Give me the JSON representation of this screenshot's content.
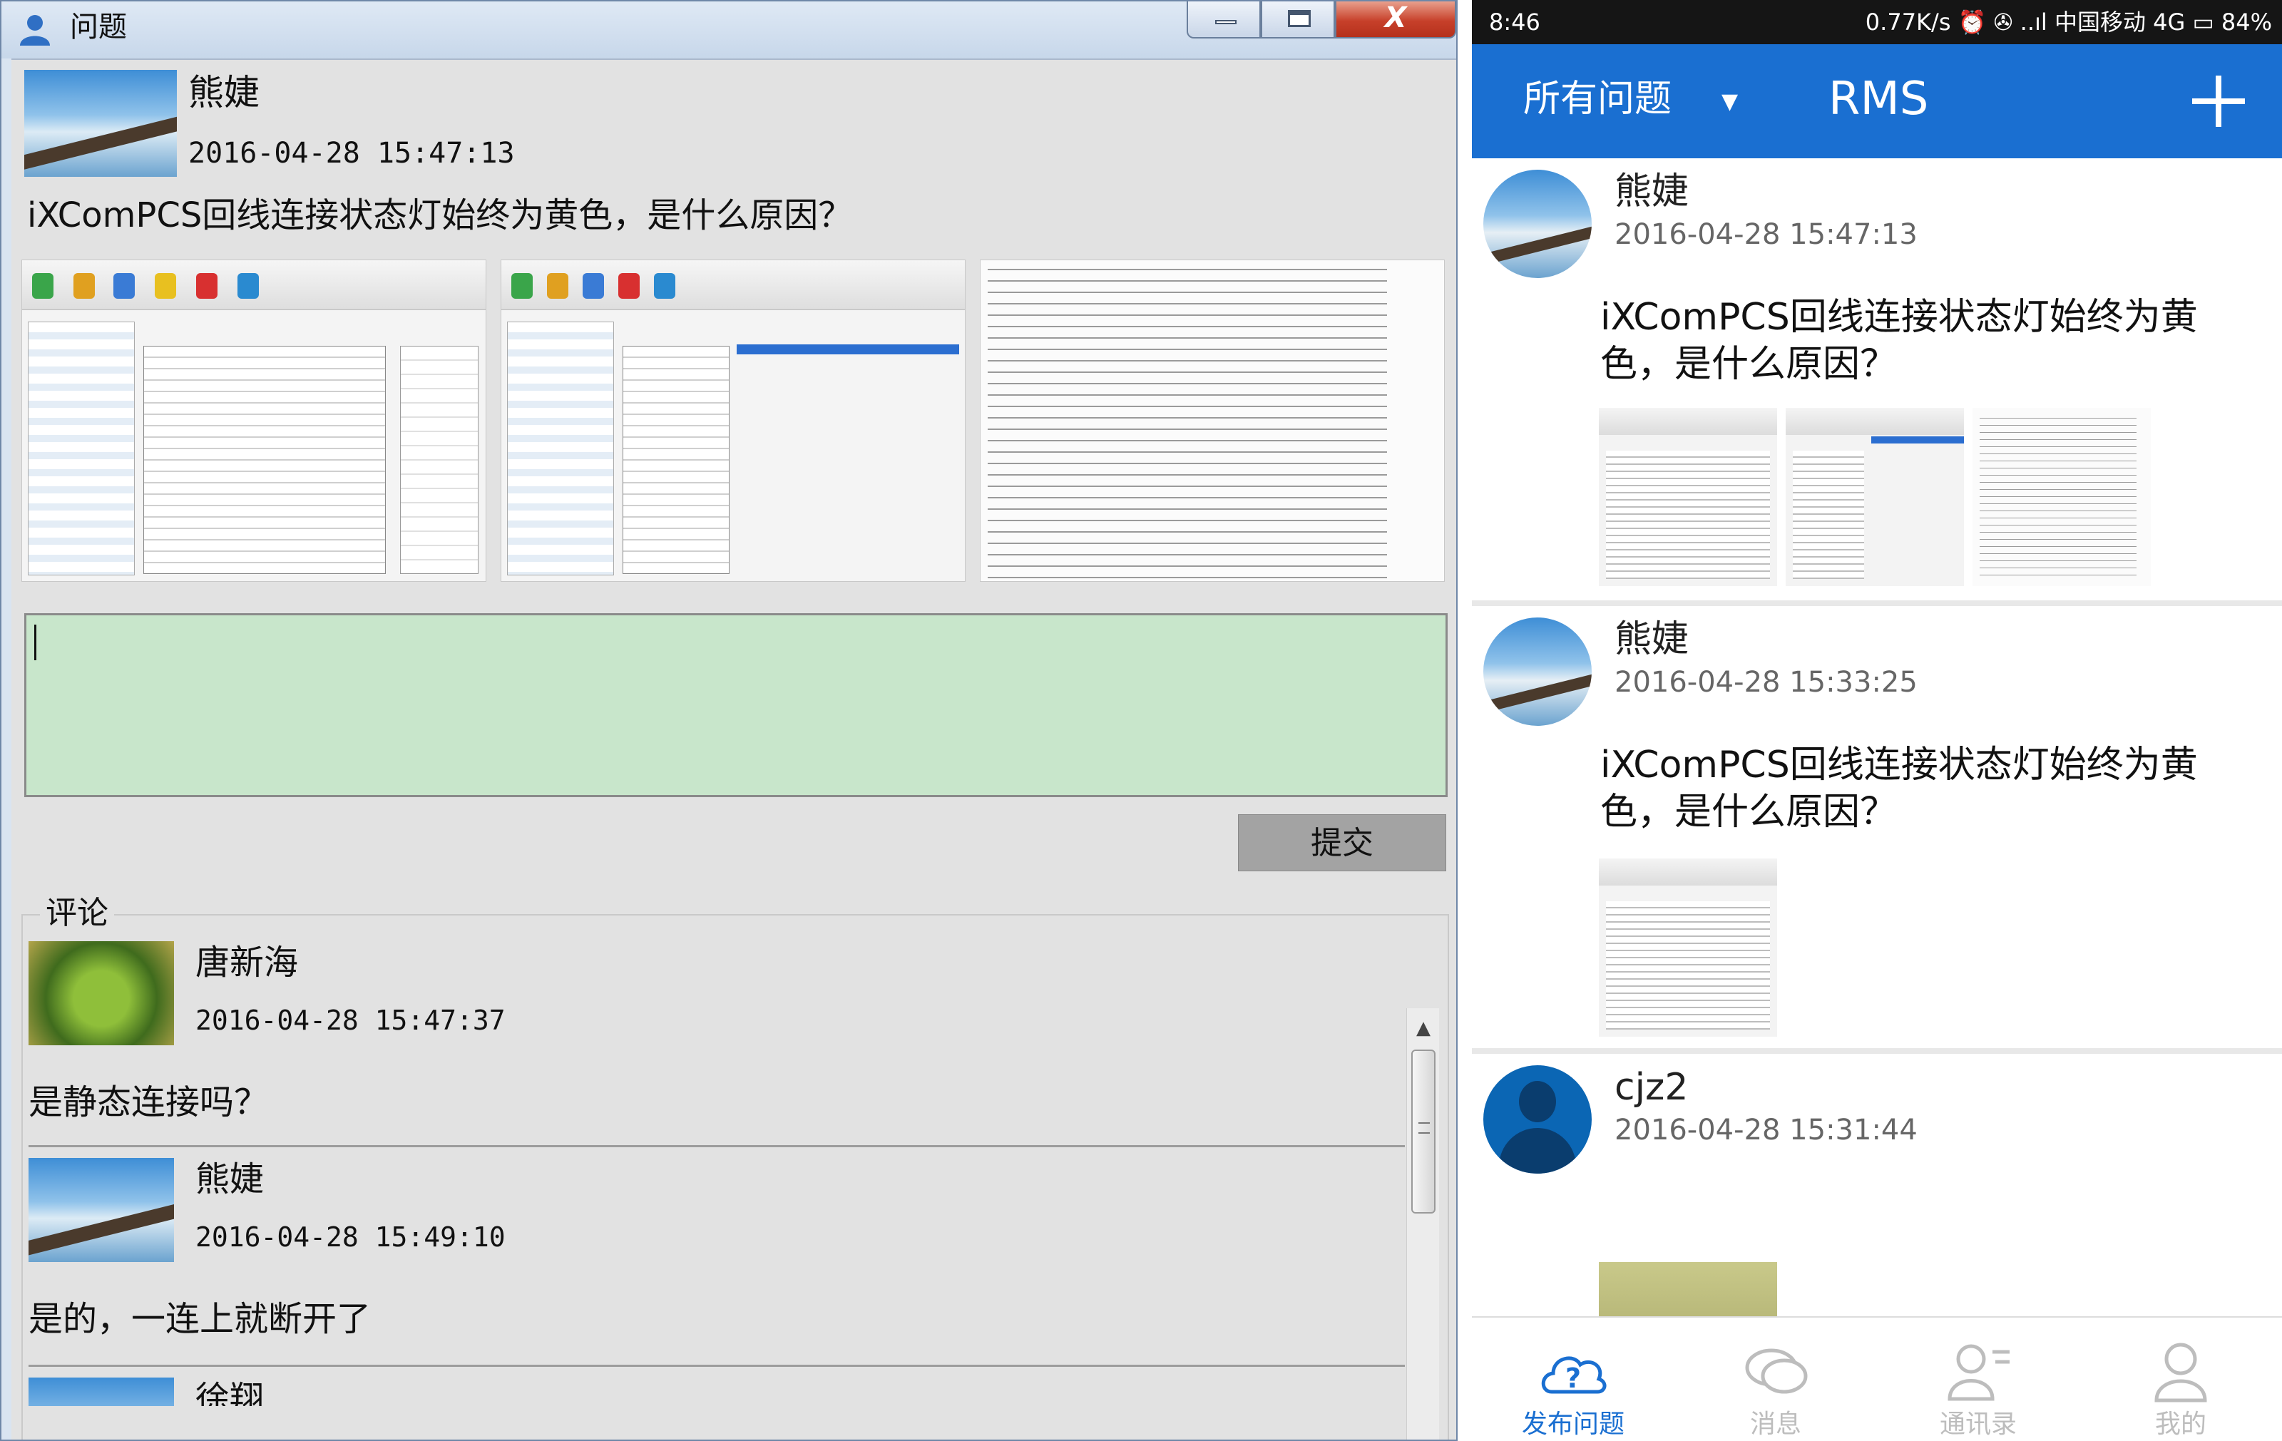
{
  "desktop": {
    "window_title": "问题",
    "close_glyph": "X",
    "question": {
      "author": "熊婕",
      "time": "2016-04-28 15:47:13",
      "text": "iXComPCS回线连接状态灯始终为黄色，是什么原因？",
      "image_count": 3
    },
    "reply": {
      "value": ""
    },
    "submit_label": "提交",
    "comments_label": "评论",
    "comments": [
      {
        "author": "唐新海",
        "time": "2016-04-28 15:47:37",
        "text": "是静态连接吗？"
      },
      {
        "author": "熊婕",
        "time": "2016-04-28 15:49:10",
        "text": "是的，一连上就断开了"
      },
      {
        "author": "徐翔",
        "time": "",
        "text": ""
      }
    ],
    "scroll_up_glyph": "▲",
    "scroll_down_glyph": "▼"
  },
  "mobile": {
    "status": {
      "time": "8:46",
      "info": "0.77K/s ⏰ ✇ ..ıl 中国移动 4G ▭ 84%"
    },
    "filter": {
      "label": "所有问题",
      "arrow": "▼"
    },
    "app_title": "RMS",
    "questions": [
      {
        "author": "熊婕",
        "time": "2016-04-28 15:47:13",
        "text": "iXComPCS回线连接状态灯始终为黄色，是什么原因？",
        "avatar": "landscape-photo"
      },
      {
        "author": "熊婕",
        "time": "2016-04-28 15:33:25",
        "text": "iXComPCS回线连接状态灯始终为黄色，是什么原因？",
        "avatar": "landscape-photo"
      },
      {
        "author": "cjz2",
        "time": "2016-04-28 15:31:44",
        "text": "",
        "avatar": "person-icon"
      }
    ],
    "nav": [
      {
        "label": "发布问题",
        "icon": "cloud-question-icon",
        "active": true
      },
      {
        "label": "消息",
        "icon": "chat-bubbles-icon",
        "active": false
      },
      {
        "label": "通讯录",
        "icon": "contacts-icon",
        "active": false
      },
      {
        "label": "我的",
        "icon": "user-icon",
        "active": false
      }
    ]
  },
  "colors": {
    "mobile_accent": "#1a6fd1",
    "reply_box": "#c8e6cb",
    "close_button": "#c7402a"
  }
}
